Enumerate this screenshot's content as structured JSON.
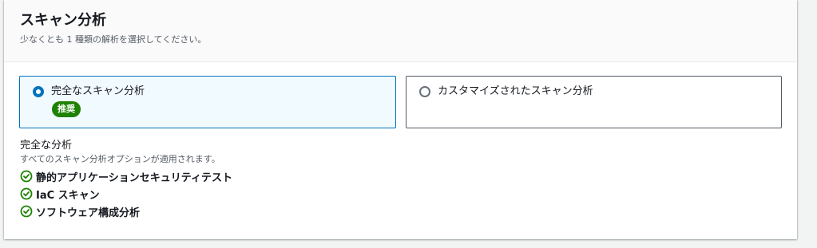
{
  "header": {
    "title": "スキャン分析",
    "description": "少なくとも 1 種類の解析を選択してください。"
  },
  "tiles": [
    {
      "label": "完全なスキャン分析",
      "badge": "推奨",
      "selected": true
    },
    {
      "label": "カスタマイズされたスキャン分析",
      "selected": false
    }
  ],
  "details": {
    "title": "完全な分析",
    "description": "すべてのスキャン分析オプションが適用されます。",
    "items": [
      {
        "label": "静的アプリケーションセキュリティテスト",
        "icon": "check-circle-icon"
      },
      {
        "label": "IaC スキャン",
        "icon": "check-circle-icon"
      },
      {
        "label": "ソフトウェア構成分析",
        "icon": "check-circle-icon"
      }
    ]
  },
  "colors": {
    "accent": "#0073bb",
    "success": "#1d8102",
    "selected_bg": "#f1faff"
  }
}
